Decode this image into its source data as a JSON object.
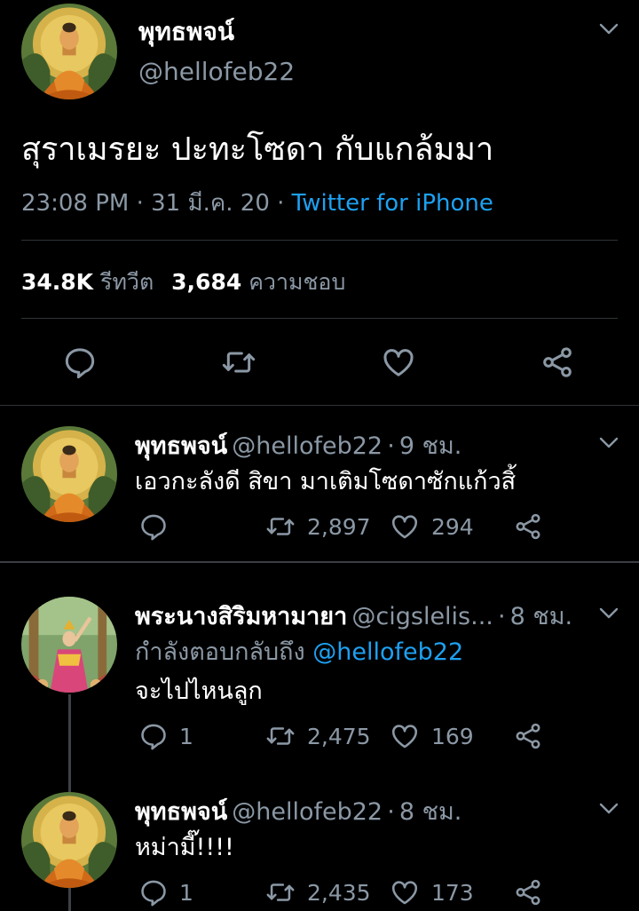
{
  "main_tweet": {
    "author_name": "พุทธพจน์",
    "author_handle": "@hellofeb22",
    "text": "สุราเมรยะ ปะทะโซดา กับแกล้มมา",
    "time": "23:08 PM",
    "date": "31 มี.ค. 20",
    "source": "Twitter for iPhone",
    "retweets_count": "34.8K",
    "retweets_label": "รีทวีต",
    "likes_count": "3,684",
    "likes_label": "ความชอบ"
  },
  "replies": [
    {
      "author_name": "พุทธพจน์",
      "author_handle": "@hellofeb22",
      "time": "9 ชม.",
      "text": "เอวกะลังดี สิขา มาเติมโซดาซักแก้วสิ้",
      "reply_count": "",
      "retweet_count": "2,897",
      "like_count": "294"
    },
    {
      "author_name": "พระนางสิริมหามายา",
      "author_handle": "@cigslelis...",
      "time": "8 ชม.",
      "replying_to_label": "กำลังตอบกลับถึง",
      "replying_to_handle": "@hellofeb22",
      "text": "จะไปไหนลูก",
      "reply_count": "1",
      "retweet_count": "2,475",
      "like_count": "169"
    },
    {
      "author_name": "พุทธพจน์",
      "author_handle": "@hellofeb22",
      "time": "8 ชม.",
      "text": "หม่ามี๊!!!!",
      "reply_count": "1",
      "retweet_count": "2,435",
      "like_count": "173"
    }
  ],
  "colors": {
    "background": "#000000",
    "text": "#ffffff",
    "muted": "#8b98a5",
    "link": "#1da1f2",
    "divider": "#2f3336"
  },
  "icons": [
    "chevron-down-icon",
    "reply-icon",
    "retweet-icon",
    "like-icon",
    "share-icon"
  ]
}
